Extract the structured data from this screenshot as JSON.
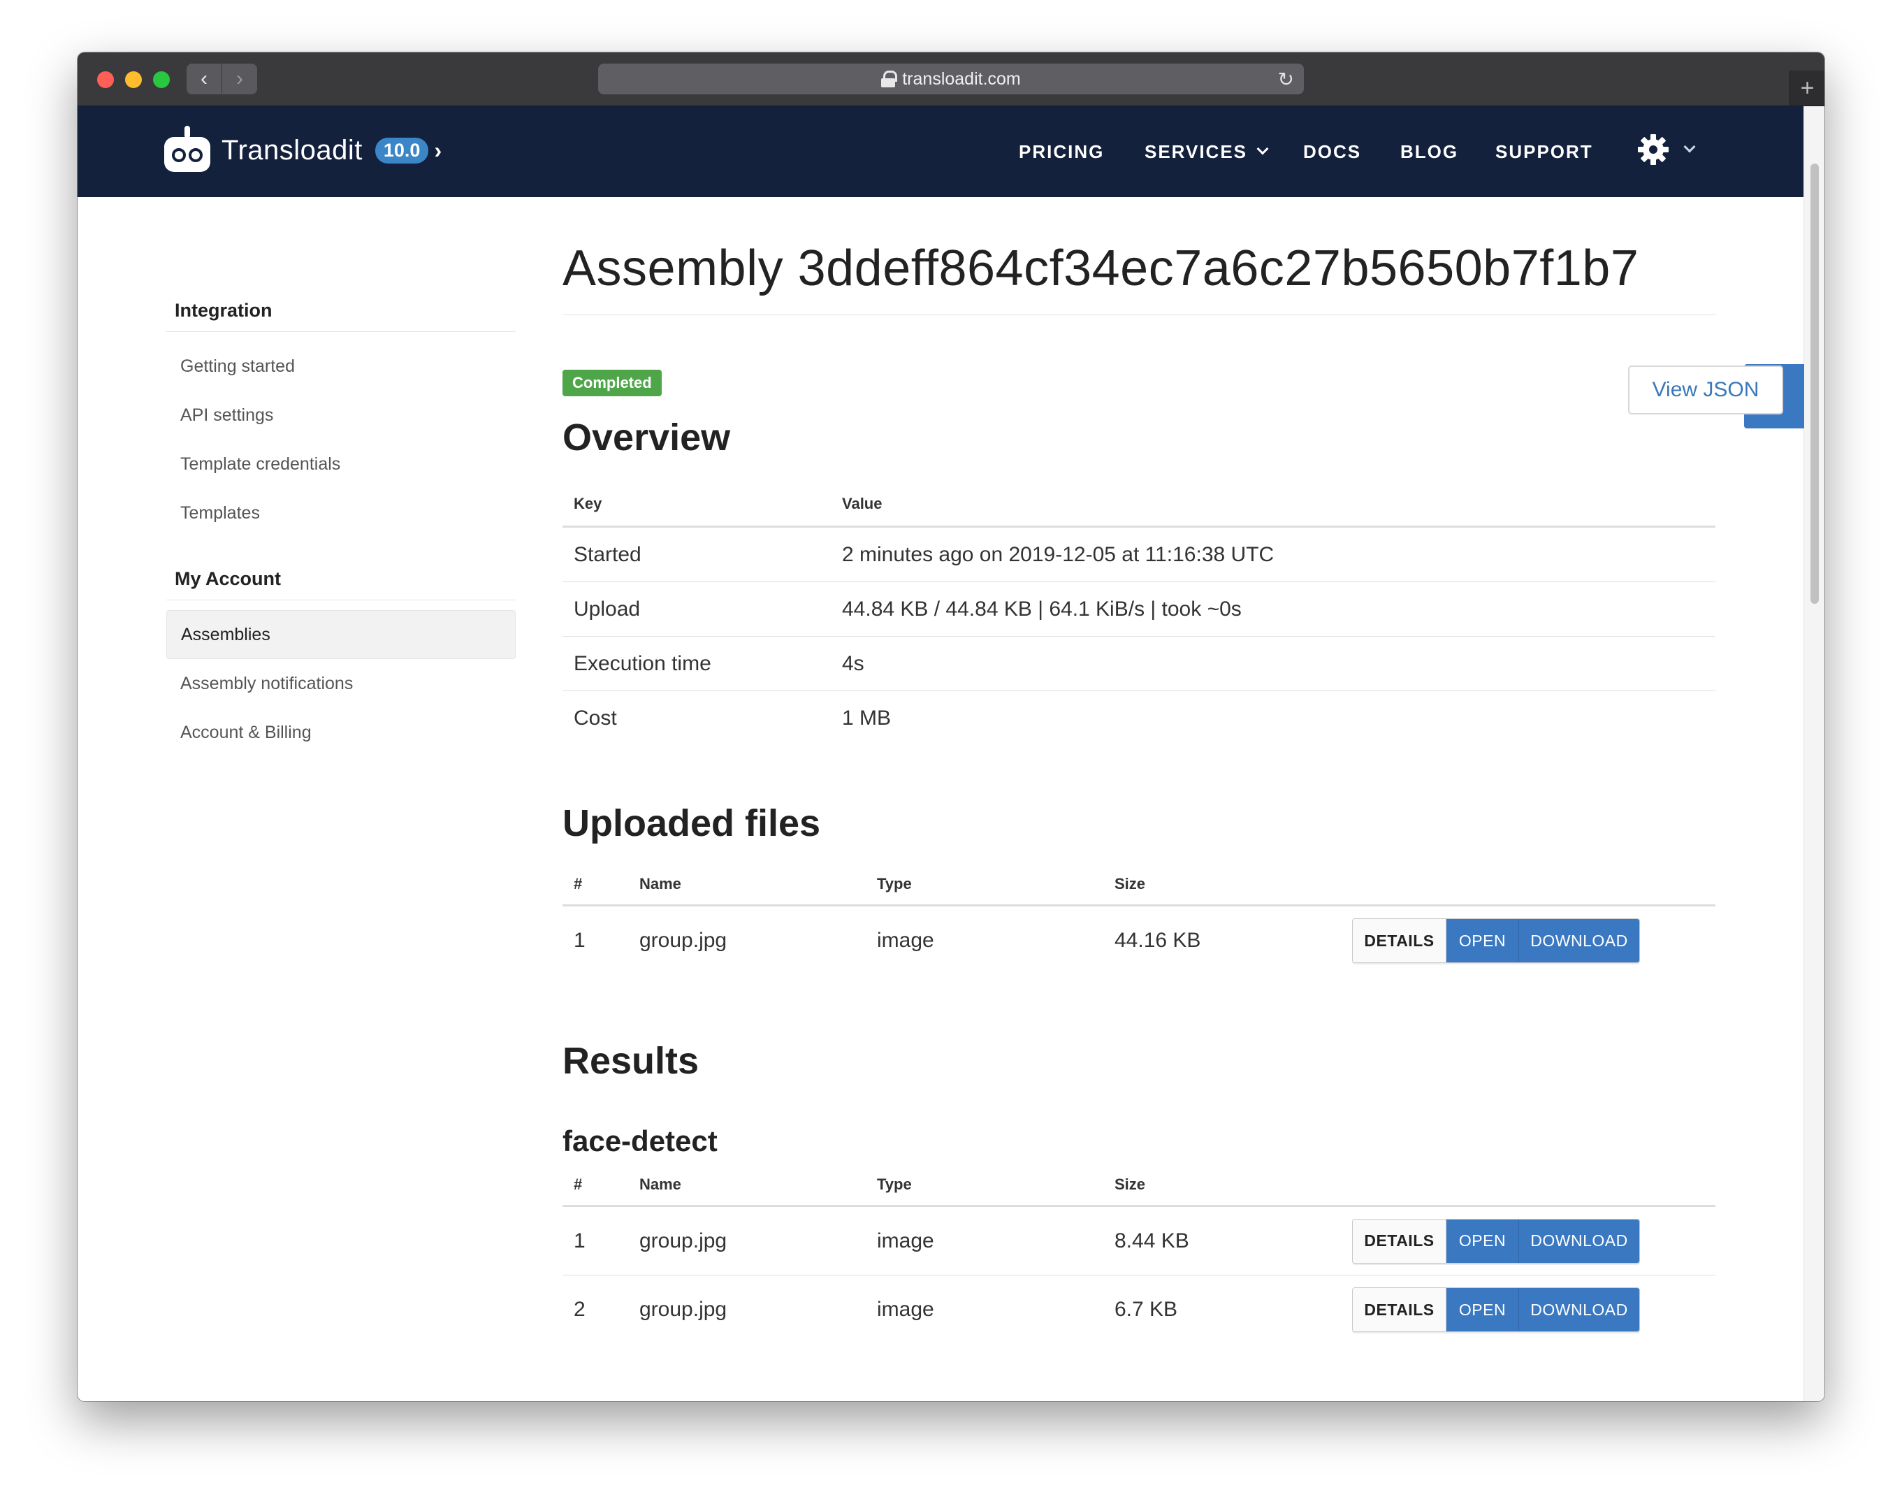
{
  "browser": {
    "url": "transloadit.com"
  },
  "header": {
    "brand": "Transloadit",
    "version": "10.0",
    "nav": {
      "pricing": "PRICING",
      "services": "SERVICES",
      "docs": "DOCS",
      "blog": "BLOG",
      "support": "SUPPORT"
    }
  },
  "sidebar": {
    "sections": [
      {
        "title": "Integration",
        "items": [
          "Getting started",
          "API settings",
          "Template credentials",
          "Templates"
        ]
      },
      {
        "title": "My Account",
        "items": [
          "Assemblies",
          "Assembly notifications",
          "Account & Billing"
        ]
      }
    ],
    "active_item": "Assemblies"
  },
  "main": {
    "title": "Assembly 3ddeff864cf34ec7a6c27b5650b7f1b7",
    "status": "Completed",
    "view_json": "View JSON",
    "overview": {
      "heading": "Overview",
      "columns": {
        "key": "Key",
        "value": "Value"
      },
      "rows": [
        {
          "key": "Started",
          "value": "2 minutes ago on 2019-12-05 at 11:16:38 UTC"
        },
        {
          "key": "Upload",
          "value": "44.84 KB / 44.84 KB | 64.1 KiB/s | took ~0s"
        },
        {
          "key": "Execution time",
          "value": "4s"
        },
        {
          "key": "Cost",
          "value": "1 MB"
        }
      ]
    },
    "file_columns": {
      "num": "#",
      "name": "Name",
      "type": "Type",
      "size": "Size"
    },
    "actions": {
      "details": "DETAILS",
      "open": "OPEN",
      "download": "DOWNLOAD"
    },
    "uploaded": {
      "heading": "Uploaded files",
      "rows": [
        {
          "num": "1",
          "name": "group.jpg",
          "type": "image",
          "size": "44.16 KB"
        }
      ]
    },
    "results": {
      "heading": "Results",
      "step": "face-detect",
      "rows": [
        {
          "num": "1",
          "name": "group.jpg",
          "type": "image",
          "size": "8.44 KB"
        },
        {
          "num": "2",
          "name": "group.jpg",
          "type": "image",
          "size": "6.7 KB"
        }
      ]
    }
  }
}
